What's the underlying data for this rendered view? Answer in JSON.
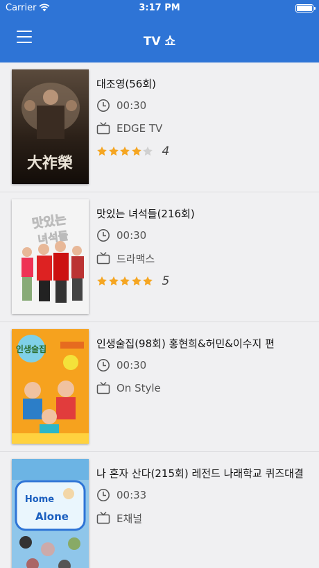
{
  "status_bar": {
    "carrier": "Carrier",
    "time": "3:17 PM"
  },
  "nav": {
    "title": "TV 쇼"
  },
  "accent_color": "#2e74d6",
  "star_color": "#f5a623",
  "shows": [
    {
      "title": "대조영(56회)",
      "time": "00:30",
      "channel": "EDGE TV",
      "rating": 4,
      "rating_label": "4"
    },
    {
      "title": "맛있는 녀석들(216회)",
      "time": "00:30",
      "channel": "드라맥스",
      "rating": 5,
      "rating_label": "5"
    },
    {
      "title": "인생술집(98회) 홍현희&허민&이수지 편",
      "time": "00:30",
      "channel": "On Style",
      "rating": null,
      "rating_label": ""
    },
    {
      "title": "나 혼자 산다(215회) 레전드 나래학교 퀴즈대결",
      "time": "00:33",
      "channel": "E채널",
      "rating": null,
      "rating_label": ""
    }
  ]
}
